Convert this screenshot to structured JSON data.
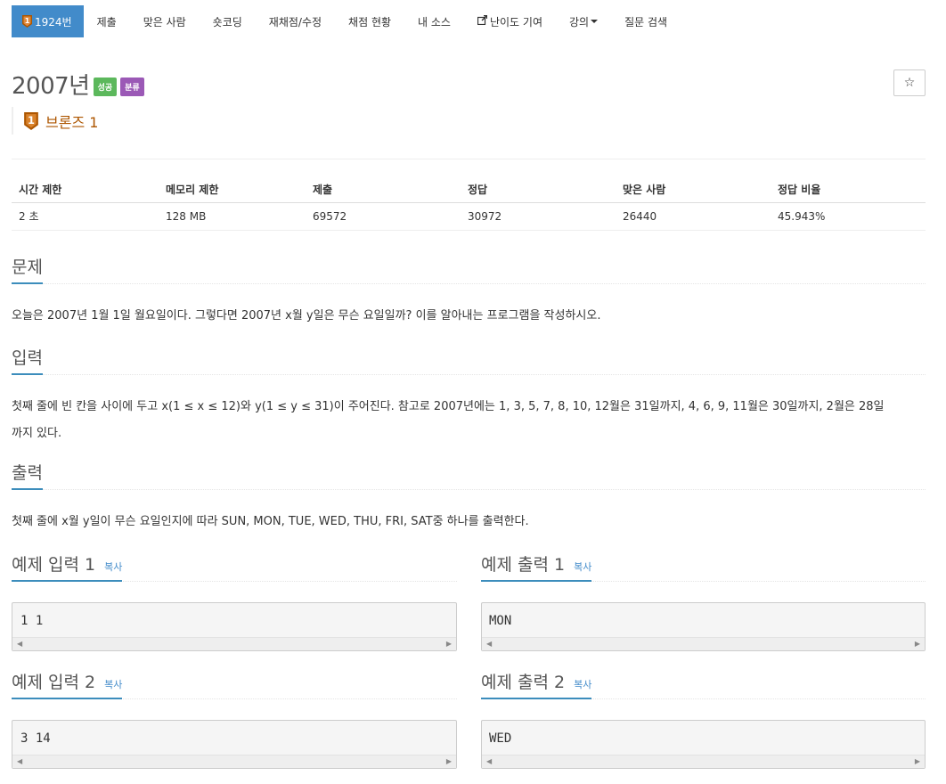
{
  "nav": {
    "problem_number": "1924번",
    "items": [
      "제출",
      "맞은 사람",
      "숏코딩",
      "재채점/수정",
      "채점 현황",
      "내 소스",
      "난이도 기여",
      "강의",
      "질문 검색"
    ]
  },
  "problem": {
    "title": "2007년",
    "label_success": "성공",
    "label_tag": "분류",
    "tier": "브론즈 1",
    "tier_number": "1",
    "star_icon": "☆"
  },
  "stats": {
    "headers": [
      "시간 제한",
      "메모리 제한",
      "제출",
      "정답",
      "맞은 사람",
      "정답 비율"
    ],
    "values": [
      "2 초",
      "128 MB",
      "69572",
      "30972",
      "26440",
      "45.943%"
    ]
  },
  "sections": {
    "description_title": "문제",
    "description": "오늘은 2007년 1월 1일 월요일이다. 그렇다면 2007년 x월 y일은 무슨 요일일까? 이를 알아내는 프로그램을 작성하시오.",
    "input_title": "입력",
    "input_line1": "첫째 줄에 빈 칸을 사이에 두고 x(1 ≤ x ≤ 12)와 y(1 ≤ y ≤ 31)이 주어진다. 참고로 2007년에는 1, 3, 5, 7, 8, 10, 12월은 31일까지, 4, 6, 9, 11월은 30일까지, 2월은 28일",
    "input_line2": "까지 있다.",
    "output_title": "출력",
    "output": "첫째 줄에 x월 y일이 무슨 요일인지에 따라 SUN, MON, TUE, WED, THU, FRI, SAT중 하나를 출력한다."
  },
  "samples": {
    "copy": "복사",
    "in1_title": "예제 입력 1",
    "out1_title": "예제 출력 1",
    "in1": "1 1",
    "out1": "MON",
    "in2_title": "예제 입력 2",
    "out2_title": "예제 출력 2",
    "in2": "3 14",
    "out2": "WED"
  },
  "colors": {
    "nav_active": "#428bca",
    "tier_bronze": "#ad5600",
    "label_success": "#5cb85c",
    "label_tag": "#9b59b6",
    "section_underline": "#3c8dbc"
  }
}
